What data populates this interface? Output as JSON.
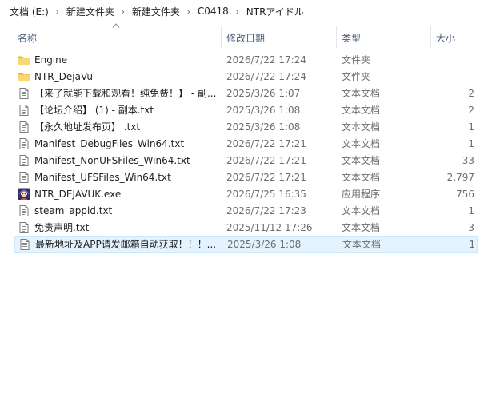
{
  "breadcrumb": {
    "items": [
      "文档 (E:)",
      "新建文件夹",
      "新建文件夹",
      "C0418",
      "NTRアイドル"
    ],
    "separator": "›"
  },
  "columns": {
    "name": "名称",
    "date": "修改日期",
    "type": "类型",
    "size": "大小"
  },
  "files": [
    {
      "name": "Engine",
      "date": "2026/7/22 17:24",
      "type": "文件夹",
      "size": "",
      "icon": "folder-icon"
    },
    {
      "name": "NTR_DejaVu",
      "date": "2026/7/22 17:24",
      "type": "文件夹",
      "size": "",
      "icon": "folder-icon"
    },
    {
      "name": "【来了就能下载和观看！纯免费！】 - 副...",
      "date": "2025/3/26 1:07",
      "type": "文本文档",
      "size": "2",
      "icon": "text-file-icon"
    },
    {
      "name": "【论坛介绍】 (1) - 副本.txt",
      "date": "2025/3/26 1:08",
      "type": "文本文档",
      "size": "2",
      "icon": "text-file-icon"
    },
    {
      "name": "【永久地址发布页】 .txt",
      "date": "2025/3/26 1:08",
      "type": "文本文档",
      "size": "1",
      "icon": "text-file-icon"
    },
    {
      "name": "Manifest_DebugFiles_Win64.txt",
      "date": "2026/7/22 17:21",
      "type": "文本文档",
      "size": "1",
      "icon": "text-file-icon"
    },
    {
      "name": "Manifest_NonUFSFiles_Win64.txt",
      "date": "2026/7/22 17:21",
      "type": "文本文档",
      "size": "33",
      "icon": "text-file-icon"
    },
    {
      "name": "Manifest_UFSFiles_Win64.txt",
      "date": "2026/7/22 17:21",
      "type": "文本文档",
      "size": "2,797",
      "icon": "text-file-icon"
    },
    {
      "name": "NTR_DEJAVUK.exe",
      "date": "2026/7/25 16:35",
      "type": "应用程序",
      "size": "756",
      "icon": "app-icon"
    },
    {
      "name": "steam_appid.txt",
      "date": "2026/7/22 17:23",
      "type": "文本文档",
      "size": "1",
      "icon": "text-file-icon"
    },
    {
      "name": "免责声明.txt",
      "date": "2025/11/12 17:26",
      "type": "文本文档",
      "size": "3",
      "icon": "text-file-icon"
    },
    {
      "name": "最新地址及APP请发邮箱自动获取！！！...",
      "date": "2025/3/26 1:08",
      "type": "文本文档",
      "size": "1",
      "icon": "text-file-icon",
      "selected": true
    }
  ],
  "colors": {
    "selection_bg": "#e5f3ff",
    "selection_border": "#cce8ff",
    "header_text": "#4c607a",
    "folder": "#f8d775"
  }
}
